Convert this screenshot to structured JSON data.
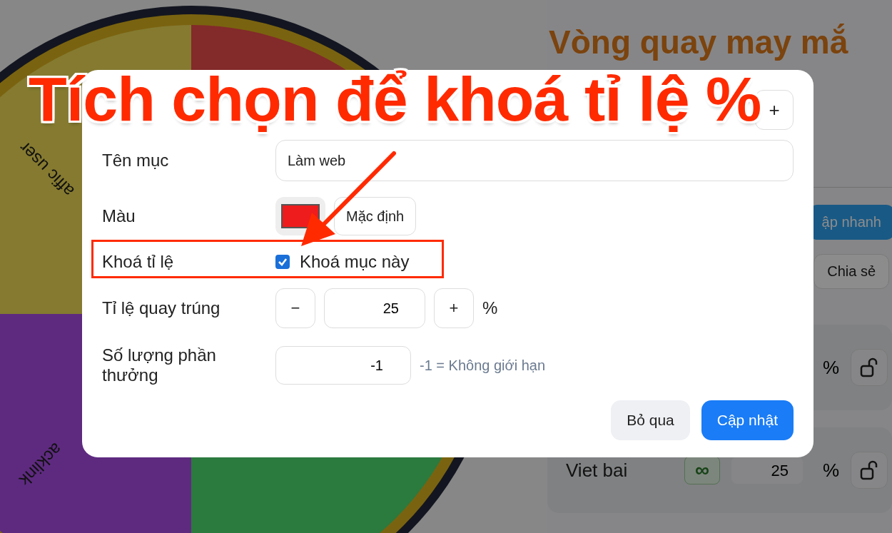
{
  "wheel": {
    "segments": [
      {
        "color": "#832a2a"
      },
      {
        "color": "#2b7a3e"
      },
      {
        "label": "acklink",
        "color": "#5e2a80"
      },
      {
        "label": "affic user",
        "color": "#857a30"
      }
    ]
  },
  "page": {
    "title": "Vòng quay may mắ",
    "buttons": [
      {
        "label": "ập nhanh",
        "kind": "primary"
      },
      {
        "label": "Chia sẻ",
        "kind": "secondary"
      }
    ],
    "rows": [
      {
        "percent": "%",
        "locked": false
      },
      {
        "name": "Viet bai",
        "limit": "∞",
        "value": "25",
        "percent": "%",
        "locked": false
      }
    ]
  },
  "dialog": {
    "header_button": "+",
    "name": {
      "label": "Tên mục",
      "value": "Làm web"
    },
    "color": {
      "label": "Màu",
      "color": "#ee1c1c",
      "reset": "Mặc định"
    },
    "lock": {
      "label": "Khoá tỉ lệ",
      "option": "Khoá mục này",
      "checked": true
    },
    "rate": {
      "label": "Tỉ lệ quay trúng",
      "minus": "−",
      "value": "25",
      "plus": "+",
      "unit": "%"
    },
    "quantity": {
      "label": "Số lượng phần thưởng",
      "value": "-1",
      "hint": "-1 = Không giới hạn"
    },
    "buttons": [
      {
        "label": "Bỏ qua",
        "kind": "secondary"
      },
      {
        "label": "Cập nhật",
        "kind": "primary"
      }
    ]
  },
  "annotation": {
    "text": "Tích chọn để khoá tỉ lệ %"
  }
}
